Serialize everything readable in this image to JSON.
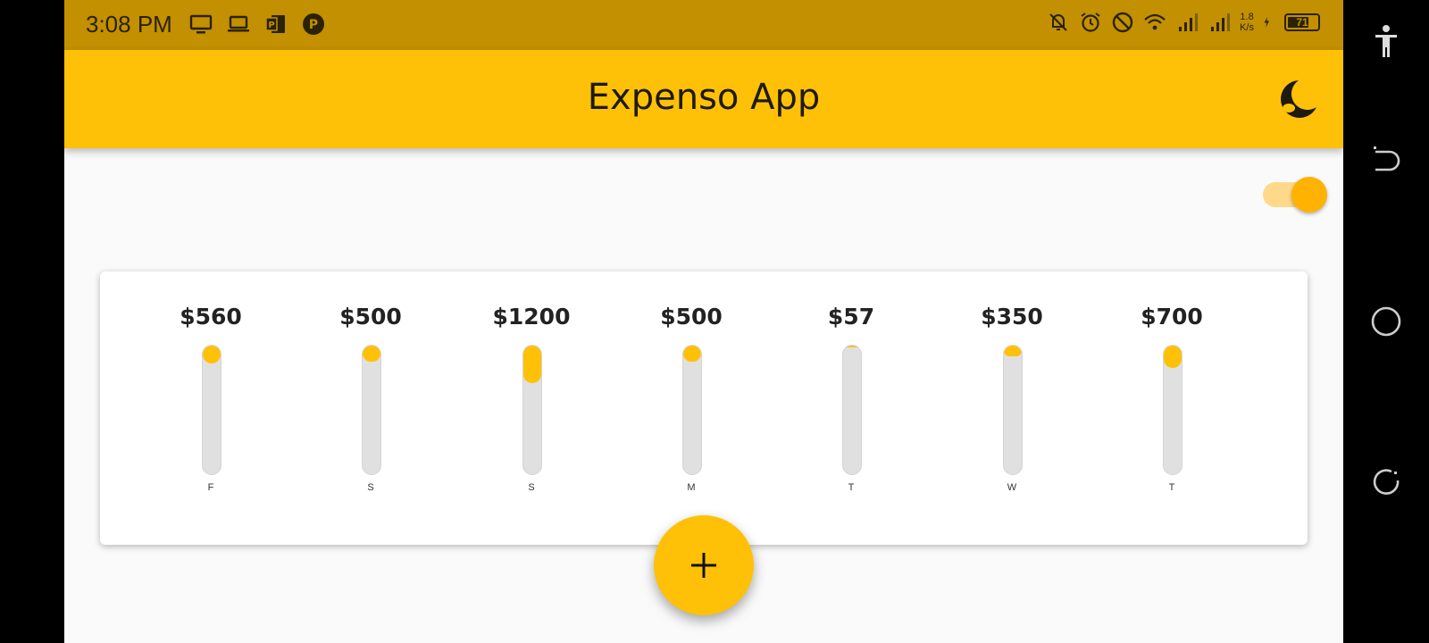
{
  "status_bar": {
    "time": "3:08 PM",
    "net_speed_value": "1.8",
    "net_speed_unit": "K/s",
    "battery_level": "71",
    "left_icons": [
      "monitor-icon",
      "laptop-icon",
      "powerpoint-icon",
      "app-p-icon"
    ],
    "right_icons": [
      "bell-off-icon",
      "alarm-icon",
      "do-not-disturb-icon",
      "wifi-icon",
      "signal-icon",
      "signal-icon",
      "charging-icon"
    ]
  },
  "app_bar": {
    "title": "Expenso App",
    "theme_icon": "moon-icon"
  },
  "toggle": {
    "on": true
  },
  "chart_data": {
    "type": "bar",
    "categories": [
      "F",
      "S",
      "S",
      "M",
      "T",
      "W",
      "T"
    ],
    "labels": [
      "$560",
      "$500",
      "$1200",
      "$500",
      "$57",
      "$350",
      "$700"
    ],
    "values": [
      560,
      500,
      1200,
      500,
      57,
      350,
      700
    ],
    "fill_fraction": [
      0.14,
      0.12,
      0.29,
      0.12,
      0.01,
      0.08,
      0.17
    ]
  },
  "fab": {
    "icon": "plus-icon"
  },
  "nav": {
    "icons": [
      "accessibility-icon",
      "back-icon",
      "home-icon",
      "recents-icon"
    ]
  },
  "colors": {
    "accent": "#ffc107",
    "status_bar": "#c29000",
    "track": "#e0e0e0",
    "switch_thumb": "#ffb300"
  }
}
